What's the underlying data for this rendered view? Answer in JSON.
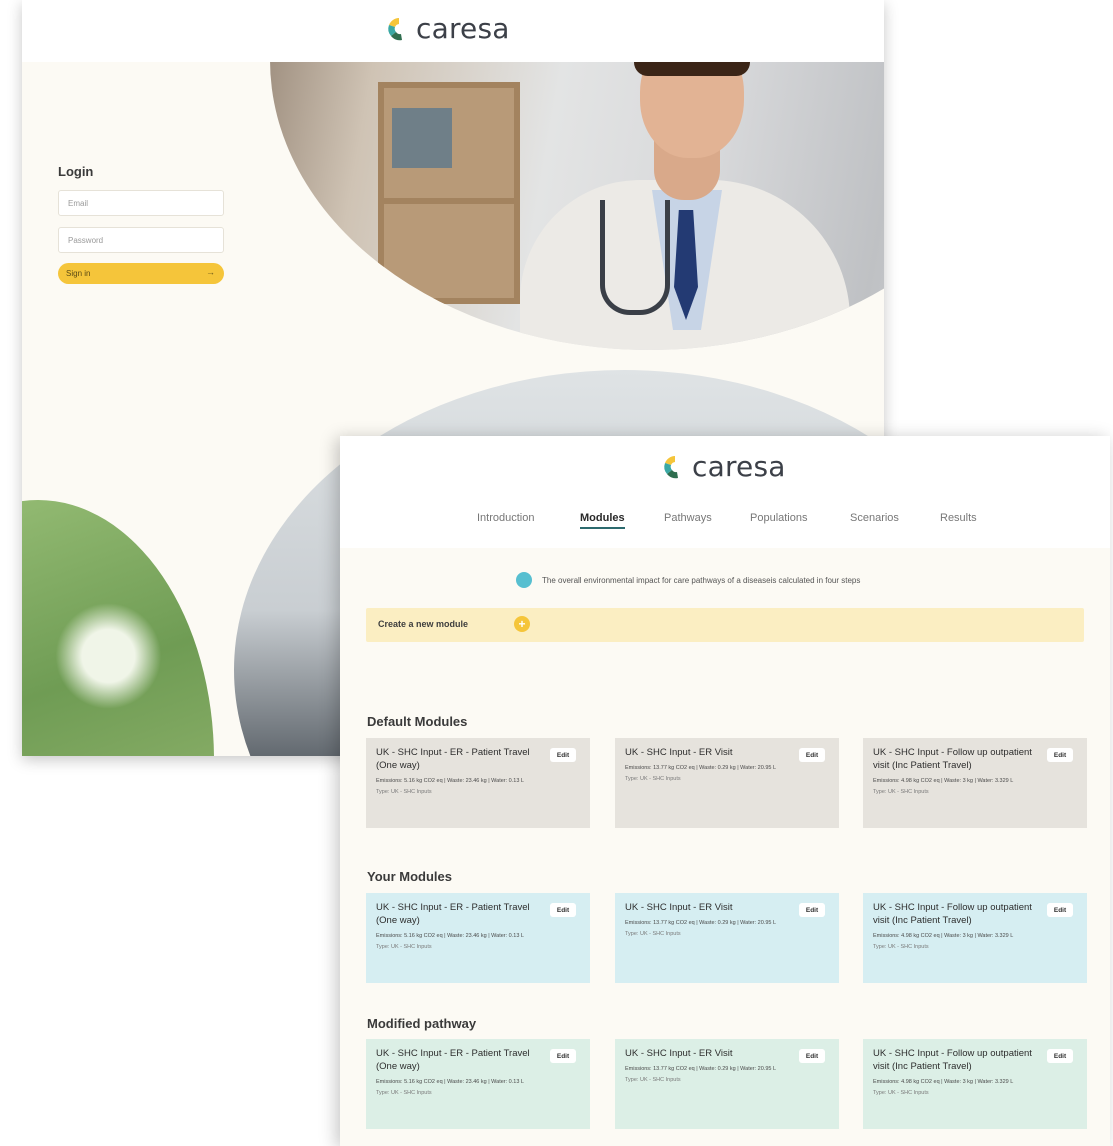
{
  "login_window": {
    "brand": "caresa",
    "title": "Login",
    "email_placeholder": "Email",
    "password_placeholder": "Password",
    "signin_label": "Sign in",
    "signin_arrow": "→"
  },
  "modules_window": {
    "brand": "caresa",
    "nav": [
      {
        "label": "Introduction",
        "active": false
      },
      {
        "label": "Modules",
        "active": true
      },
      {
        "label": "Pathways",
        "active": false
      },
      {
        "label": "Populations",
        "active": false
      },
      {
        "label": "Scenarios",
        "active": false
      },
      {
        "label": "Results",
        "active": false
      }
    ],
    "info_text": "The overall environmental impact for care pathways of a diseaseis calculated in four steps",
    "create_label": "Create a new module",
    "create_icon": "+",
    "sections": [
      {
        "title": "Default Modules",
        "style": "grey",
        "cards": [
          {
            "title": "UK - SHC Input - ER - Patient Travel (One way)",
            "edit": "Edit",
            "stats": "Emissions: 5.16 kg CO2 eq | Waste: 23.46 kg | Water: 0.13 L",
            "type": "Type: UK - SHC Inputs"
          },
          {
            "title": "UK - SHC Input - ER Visit",
            "edit": "Edit",
            "stats": "Emissions: 13.77 kg CO2 eq | Waste: 0.29 kg | Water: 20.95 L",
            "type": "Type: UK - SHC Inputs"
          },
          {
            "title": "UK - SHC Input - Follow up outpatient visit (Inc Patient Travel)",
            "edit": "Edit",
            "stats": "Emissions: 4.98 kg CO2 eq | Waste: 3 kg | Water: 3.329 L",
            "type": "Type: UK - SHC Inputs"
          }
        ]
      },
      {
        "title": "Your Modules",
        "style": "blue",
        "cards": [
          {
            "title": "UK - SHC Input - ER - Patient Travel (One way)",
            "edit": "Edit",
            "stats": "Emissions: 5.16 kg CO2 eq | Waste: 23.46 kg | Water: 0.13 L",
            "type": "Type: UK - SHC Inputs"
          },
          {
            "title": "UK - SHC Input - ER Visit",
            "edit": "Edit",
            "stats": "Emissions: 13.77 kg CO2 eq | Waste: 0.29 kg | Water: 20.95 L",
            "type": "Type: UK - SHC Inputs"
          },
          {
            "title": "UK - SHC Input - Follow up outpatient visit (Inc Patient Travel)",
            "edit": "Edit",
            "stats": "Emissions: 4.98 kg CO2 eq | Waste: 3 kg | Water: 3.329 L",
            "type": "Type: UK - SHC Inputs"
          }
        ]
      },
      {
        "title": "Modified pathway",
        "style": "green",
        "cards": [
          {
            "title": "UK - SHC Input - ER - Patient Travel (One way)",
            "edit": "Edit",
            "stats": "Emissions: 5.16 kg CO2 eq | Waste: 23.46 kg | Water: 0.13 L",
            "type": "Type: UK - SHC Inputs"
          },
          {
            "title": "UK - SHC Input - ER Visit",
            "edit": "Edit",
            "stats": "Emissions: 13.77 kg CO2 eq | Waste: 0.29 kg | Water: 20.95 L",
            "type": "Type: UK - SHC Inputs"
          },
          {
            "title": "UK - SHC Input - Follow up outpatient visit (Inc Patient Travel)",
            "edit": "Edit",
            "stats": "Emissions: 4.98 kg CO2 eq | Waste: 3 kg | Water: 3.329 L",
            "type": "Type: UK - SHC Inputs"
          }
        ]
      }
    ]
  },
  "colors": {
    "brand_teal": "#3aa8a4",
    "brand_yellow": "#f5c53a",
    "brand_green": "#2f6e4f",
    "info_blue": "#57bfd0",
    "background_cream": "#fcfaf4"
  }
}
